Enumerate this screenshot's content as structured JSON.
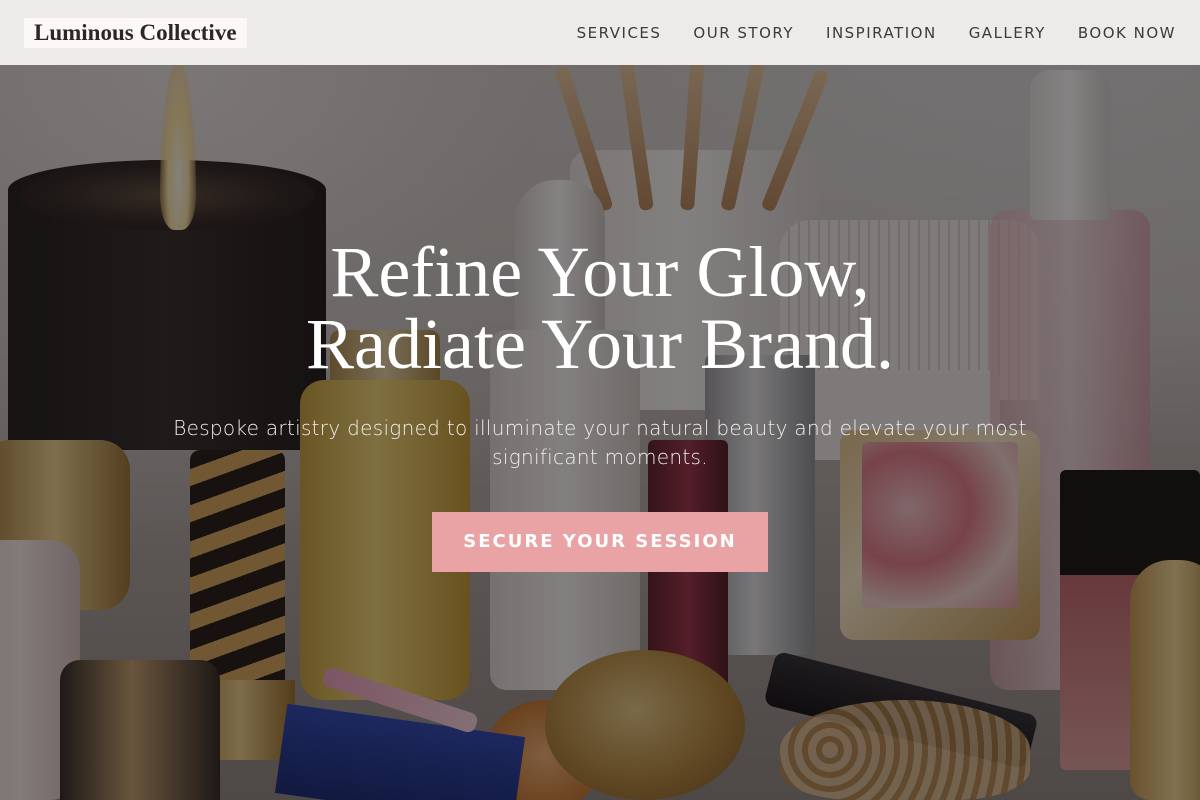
{
  "site": {
    "logo_text": "Luminous Collective"
  },
  "nav": {
    "items": [
      {
        "label": "SERVICES"
      },
      {
        "label": "OUR STORY"
      },
      {
        "label": "INSPIRATION"
      },
      {
        "label": "GALLERY"
      },
      {
        "label": "BOOK NOW"
      }
    ]
  },
  "hero": {
    "headline_line1": "Refine Your Glow,",
    "headline_line2": "Radiate Your Brand.",
    "subtext": "Bespoke artistry designed to illuminate your natural beauty and elevate your most significant moments.",
    "cta_label": "SECURE YOUR SESSION",
    "background_description_icon": "cosmetics-vanity-photo"
  },
  "colors": {
    "cta_background": "#e9a3a5",
    "header_background": "#f6f4f3",
    "text_on_hero": "#ffffff"
  }
}
